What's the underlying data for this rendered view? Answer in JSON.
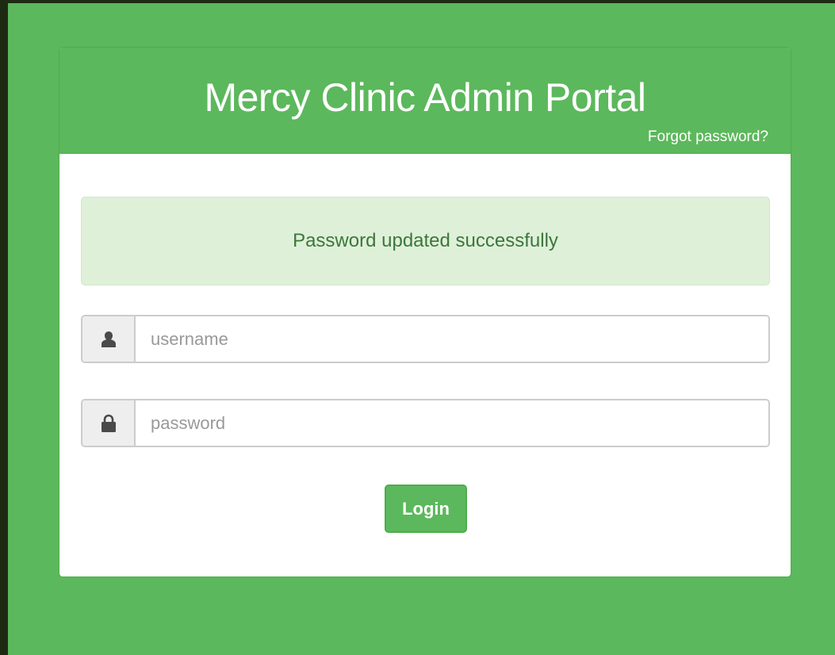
{
  "header": {
    "title": "Mercy Clinic Admin Portal",
    "forgot_password_label": "Forgot password?"
  },
  "alert": {
    "message": "Password updated successfully"
  },
  "form": {
    "username": {
      "placeholder": "username",
      "value": "",
      "icon": "user-icon"
    },
    "password": {
      "placeholder": "password",
      "value": "",
      "icon": "lock-icon"
    },
    "login_label": "Login"
  },
  "colors": {
    "brand_green": "#5cb85c",
    "alert_bg": "#dff0d8",
    "alert_text": "#3c763d",
    "outer_dark": "#1e2b13"
  }
}
